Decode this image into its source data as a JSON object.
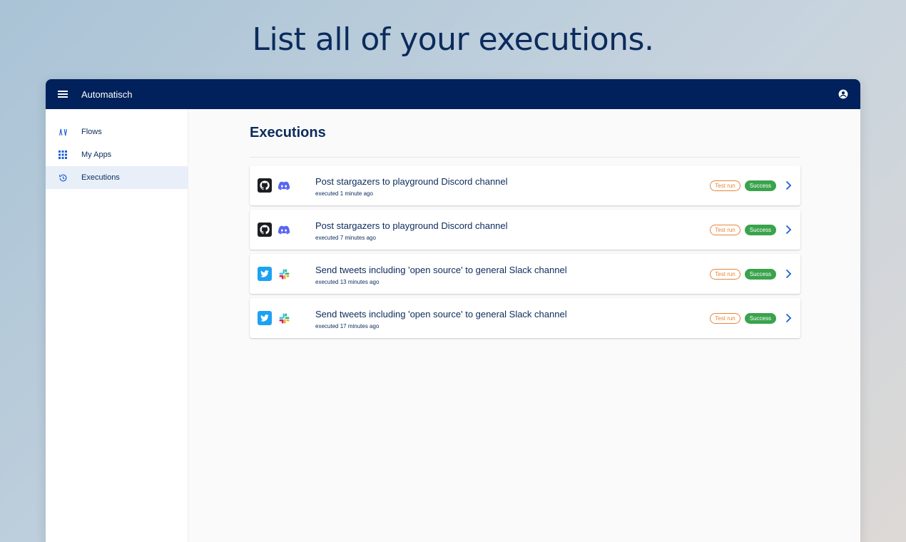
{
  "hero": {
    "title": "List all of your executions."
  },
  "appbar": {
    "title": "Automatisch"
  },
  "sidebar": {
    "items": [
      {
        "label": "Flows",
        "icon": "flows-icon"
      },
      {
        "label": "My Apps",
        "icon": "apps-grid-icon"
      },
      {
        "label": "Executions",
        "icon": "history-icon",
        "active": true
      }
    ]
  },
  "main": {
    "title": "Executions",
    "executions": [
      {
        "name": "Post stargazers to playground Discord channel",
        "executed": "executed 1 minute ago",
        "apps": [
          "github-icon",
          "discord-icon"
        ],
        "test_label": "Test run",
        "status": "Success"
      },
      {
        "name": "Post stargazers to playground Discord channel",
        "executed": "executed 7 minutes ago",
        "apps": [
          "github-icon",
          "discord-icon"
        ],
        "test_label": "Test run",
        "status": "Success"
      },
      {
        "name": "Send tweets including 'open source' to general Slack channel",
        "executed": "executed 13 minutes ago",
        "apps": [
          "twitter-icon",
          "slack-icon"
        ],
        "test_label": "Test run",
        "status": "Success"
      },
      {
        "name": "Send tweets including 'open source' to general Slack channel",
        "executed": "executed 17 minutes ago",
        "apps": [
          "twitter-icon",
          "slack-icon"
        ],
        "test_label": "Test run",
        "status": "Success"
      }
    ]
  },
  "colors": {
    "appbar": "#00215b",
    "text": "#0b2b5c",
    "test_badge": "#e8863a",
    "success_badge": "#3aa34c",
    "chevron": "#1d5fd6"
  }
}
